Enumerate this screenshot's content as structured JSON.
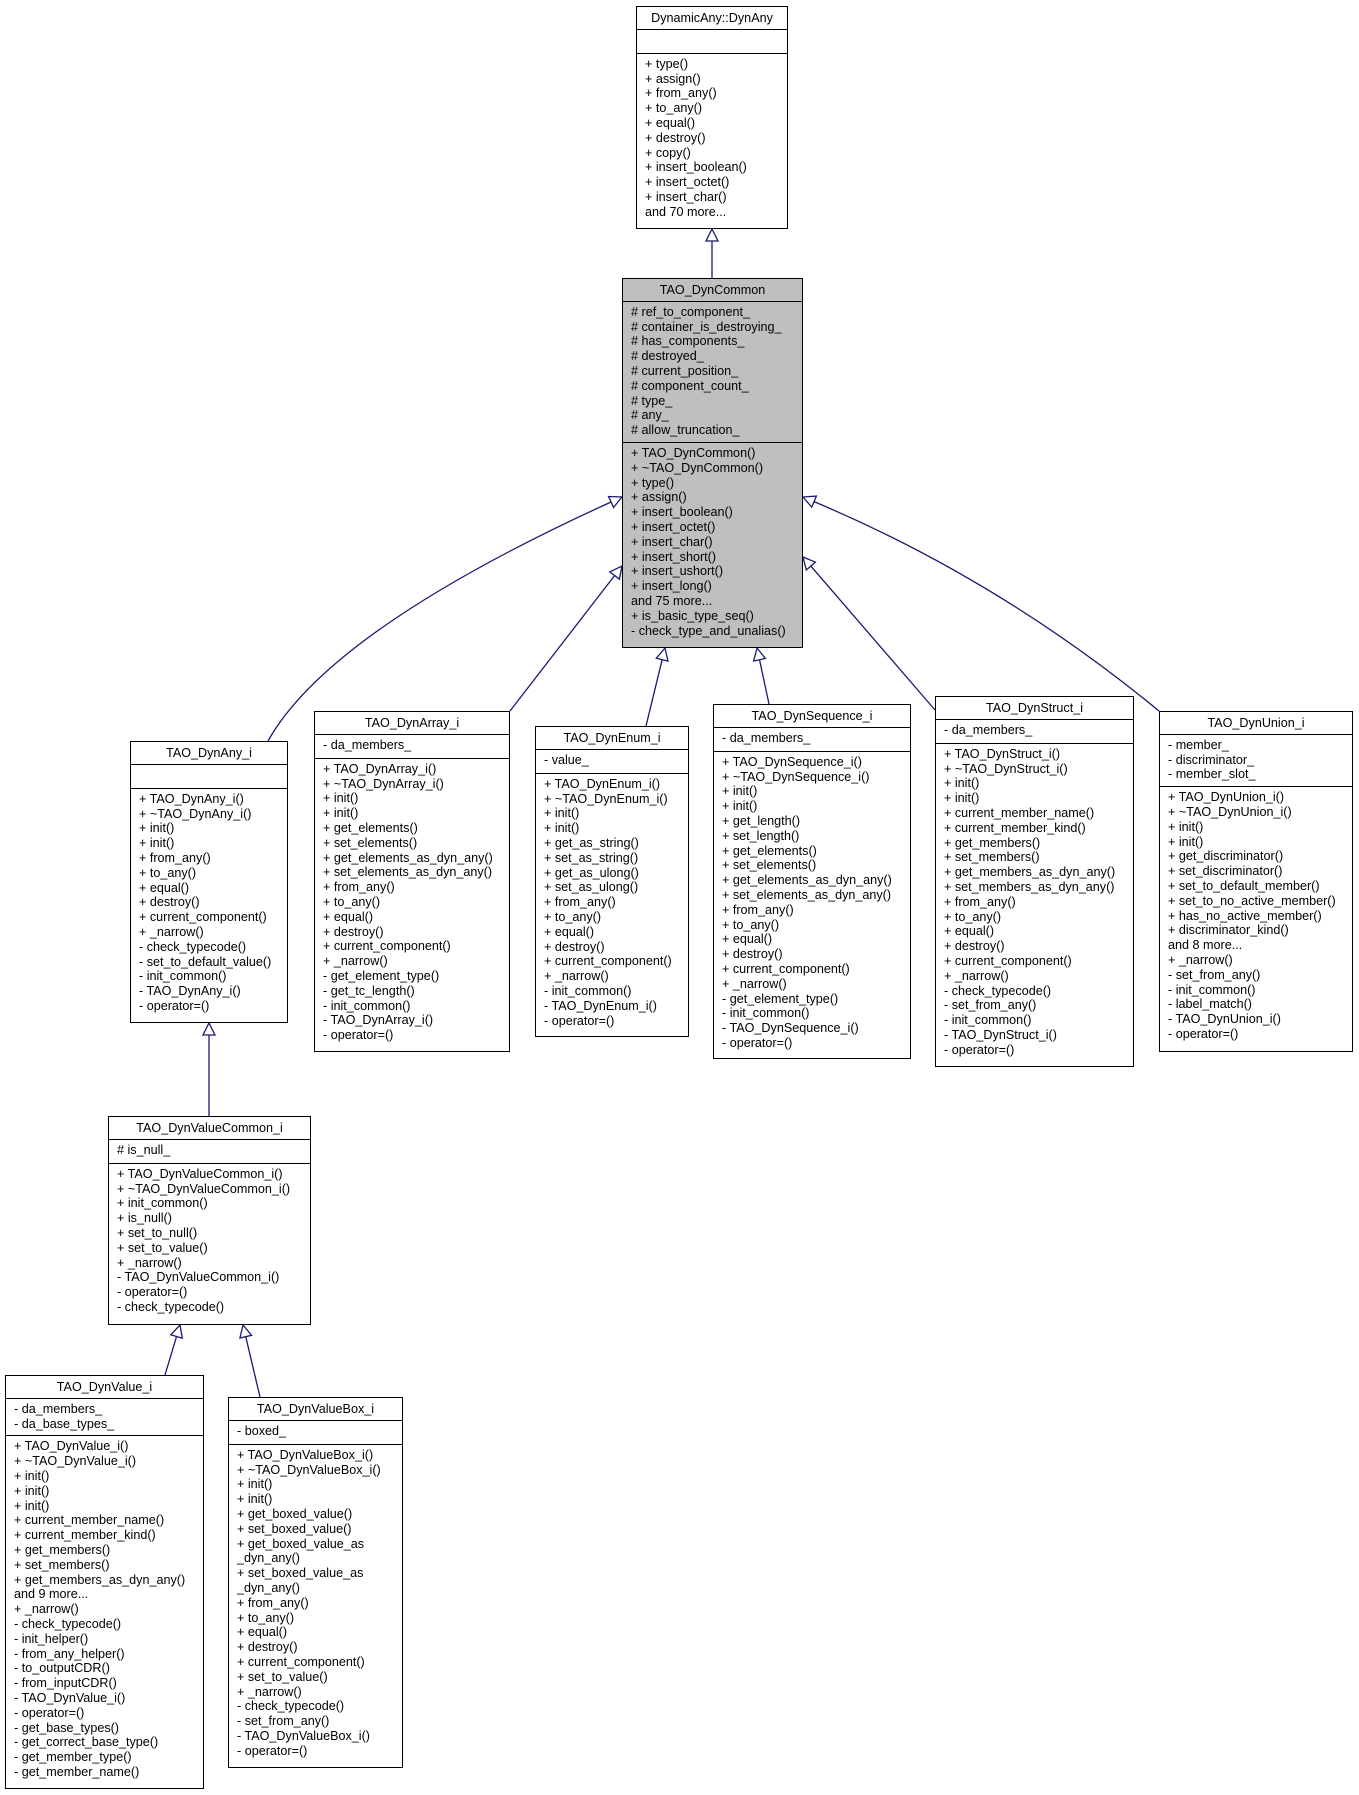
{
  "diagram": {
    "type": "uml-class-inheritance",
    "edge_color": "#191970",
    "highlight_fill": "#bfbfbf"
  },
  "classes": {
    "dynany": {
      "name": "DynamicAny::DynAny",
      "attributes": [],
      "operations": [
        "+ type()",
        "+ assign()",
        "+ from_any()",
        "+ to_any()",
        "+ equal()",
        "+ destroy()",
        "+ copy()",
        "+ insert_boolean()",
        "+ insert_octet()",
        "+ insert_char()",
        "and 70 more..."
      ]
    },
    "dyncommon": {
      "name": "TAO_DynCommon",
      "attributes": [
        "# ref_to_component_",
        "# container_is_destroying_",
        "# has_components_",
        "# destroyed_",
        "# current_position_",
        "# component_count_",
        "# type_",
        "# any_",
        "# allow_truncation_"
      ],
      "operations": [
        "+ TAO_DynCommon()",
        "+ ~TAO_DynCommon()",
        "+ type()",
        "+ assign()",
        "+ insert_boolean()",
        "+ insert_octet()",
        "+ insert_char()",
        "+ insert_short()",
        "+ insert_ushort()",
        "+ insert_long()",
        "and 75 more...",
        "+ is_basic_type_seq()",
        "- check_type_and_unalias()"
      ]
    },
    "dynany_i": {
      "name": "TAO_DynAny_i",
      "attributes": [],
      "operations": [
        "+ TAO_DynAny_i()",
        "+ ~TAO_DynAny_i()",
        "+ init()",
        "+ init()",
        "+ from_any()",
        "+ to_any()",
        "+ equal()",
        "+ destroy()",
        "+ current_component()",
        "+ _narrow()",
        "- check_typecode()",
        "- set_to_default_value()",
        "- init_common()",
        "- TAO_DynAny_i()",
        "- operator=()"
      ]
    },
    "dynarray_i": {
      "name": "TAO_DynArray_i",
      "attributes": [
        "- da_members_"
      ],
      "operations": [
        "+ TAO_DynArray_i()",
        "+ ~TAO_DynArray_i()",
        "+ init()",
        "+ init()",
        "+ get_elements()",
        "+ set_elements()",
        "+ get_elements_as_dyn_any()",
        "+ set_elements_as_dyn_any()",
        "+ from_any()",
        "+ to_any()",
        "+ equal()",
        "+ destroy()",
        "+ current_component()",
        "+ _narrow()",
        "- get_element_type()",
        "- get_tc_length()",
        "- init_common()",
        "- TAO_DynArray_i()",
        "- operator=()"
      ]
    },
    "dynenum_i": {
      "name": "TAO_DynEnum_i",
      "attributes": [
        "- value_"
      ],
      "operations": [
        "+ TAO_DynEnum_i()",
        "+ ~TAO_DynEnum_i()",
        "+ init()",
        "+ init()",
        "+ get_as_string()",
        "+ set_as_string()",
        "+ get_as_ulong()",
        "+ set_as_ulong()",
        "+ from_any()",
        "+ to_any()",
        "+ equal()",
        "+ destroy()",
        "+ current_component()",
        "+ _narrow()",
        "- init_common()",
        "- TAO_DynEnum_i()",
        "- operator=()"
      ]
    },
    "dynsequence_i": {
      "name": "TAO_DynSequence_i",
      "attributes": [
        "- da_members_"
      ],
      "operations": [
        "+ TAO_DynSequence_i()",
        "+ ~TAO_DynSequence_i()",
        "+ init()",
        "+ init()",
        "+ get_length()",
        "+ set_length()",
        "+ get_elements()",
        "+ set_elements()",
        "+ get_elements_as_dyn_any()",
        "+ set_elements_as_dyn_any()",
        "+ from_any()",
        "+ to_any()",
        "+ equal()",
        "+ destroy()",
        "+ current_component()",
        "+ _narrow()",
        "- get_element_type()",
        "- init_common()",
        "- TAO_DynSequence_i()",
        "- operator=()"
      ]
    },
    "dynstruct_i": {
      "name": "TAO_DynStruct_i",
      "attributes": [
        "- da_members_"
      ],
      "operations": [
        "+ TAO_DynStruct_i()",
        "+ ~TAO_DynStruct_i()",
        "+ init()",
        "+ init()",
        "+ current_member_name()",
        "+ current_member_kind()",
        "+ get_members()",
        "+ set_members()",
        "+ get_members_as_dyn_any()",
        "+ set_members_as_dyn_any()",
        "+ from_any()",
        "+ to_any()",
        "+ equal()",
        "+ destroy()",
        "+ current_component()",
        "+ _narrow()",
        "- check_typecode()",
        "- set_from_any()",
        "- init_common()",
        "- TAO_DynStruct_i()",
        "- operator=()"
      ]
    },
    "dynunion_i": {
      "name": "TAO_DynUnion_i",
      "attributes": [
        "- member_",
        "- discriminator_",
        "- member_slot_"
      ],
      "operations": [
        "+ TAO_DynUnion_i()",
        "+ ~TAO_DynUnion_i()",
        "+ init()",
        "+ init()",
        "+ get_discriminator()",
        "+ set_discriminator()",
        "+ set_to_default_member()",
        "+ set_to_no_active_member()",
        "+ has_no_active_member()",
        "+ discriminator_kind()",
        "and 8 more...",
        "+ _narrow()",
        "- set_from_any()",
        "- init_common()",
        "- label_match()",
        "- TAO_DynUnion_i()",
        "- operator=()"
      ]
    },
    "dynvaluecommon_i": {
      "name": "TAO_DynValueCommon_i",
      "attributes": [
        "# is_null_"
      ],
      "operations": [
        "+ TAO_DynValueCommon_i()",
        "+ ~TAO_DynValueCommon_i()",
        "+ init_common()",
        "+ is_null()",
        "+ set_to_null()",
        "+ set_to_value()",
        "+ _narrow()",
        "- TAO_DynValueCommon_i()",
        "- operator=()",
        "- check_typecode()"
      ]
    },
    "dynvalue_i": {
      "name": "TAO_DynValue_i",
      "attributes": [
        "- da_members_",
        "- da_base_types_"
      ],
      "operations": [
        "+ TAO_DynValue_i()",
        "+ ~TAO_DynValue_i()",
        "+ init()",
        "+ init()",
        "+ init()",
        "+ current_member_name()",
        "+ current_member_kind()",
        "+ get_members()",
        "+ set_members()",
        "+ get_members_as_dyn_any()",
        "and 9 more...",
        "+ _narrow()",
        "- check_typecode()",
        "- init_helper()",
        "- from_any_helper()",
        "- to_outputCDR()",
        "- from_inputCDR()",
        "- TAO_DynValue_i()",
        "- operator=()",
        "- get_base_types()",
        "- get_correct_base_type()",
        "- get_member_type()",
        "- get_member_name()"
      ]
    },
    "dynvaluebox_i": {
      "name": "TAO_DynValueBox_i",
      "attributes": [
        "- boxed_"
      ],
      "operations": [
        "+ TAO_DynValueBox_i()",
        "+ ~TAO_DynValueBox_i()",
        "+ init()",
        "+ init()",
        "+ get_boxed_value()",
        "+ set_boxed_value()",
        "+ get_boxed_value_as",
        "_dyn_any()",
        "+ set_boxed_value_as",
        "_dyn_any()",
        "+ from_any()",
        "+ to_any()",
        "+ equal()",
        "+ destroy()",
        "+ current_component()",
        "+ set_to_value()",
        "+ _narrow()",
        "- check_typecode()",
        "- set_from_any()",
        "- TAO_DynValueBox_i()",
        "- operator=()"
      ]
    }
  },
  "inheritance": [
    {
      "child": "dyncommon",
      "parent": "dynany"
    },
    {
      "child": "dynany_i",
      "parent": "dyncommon"
    },
    {
      "child": "dynarray_i",
      "parent": "dyncommon"
    },
    {
      "child": "dynenum_i",
      "parent": "dyncommon"
    },
    {
      "child": "dynsequence_i",
      "parent": "dyncommon"
    },
    {
      "child": "dynstruct_i",
      "parent": "dyncommon"
    },
    {
      "child": "dynunion_i",
      "parent": "dyncommon"
    },
    {
      "child": "dynvaluecommon_i",
      "parent": "dynany_i"
    },
    {
      "child": "dynvalue_i",
      "parent": "dynvaluecommon_i"
    },
    {
      "child": "dynvaluebox_i",
      "parent": "dynvaluecommon_i"
    }
  ]
}
